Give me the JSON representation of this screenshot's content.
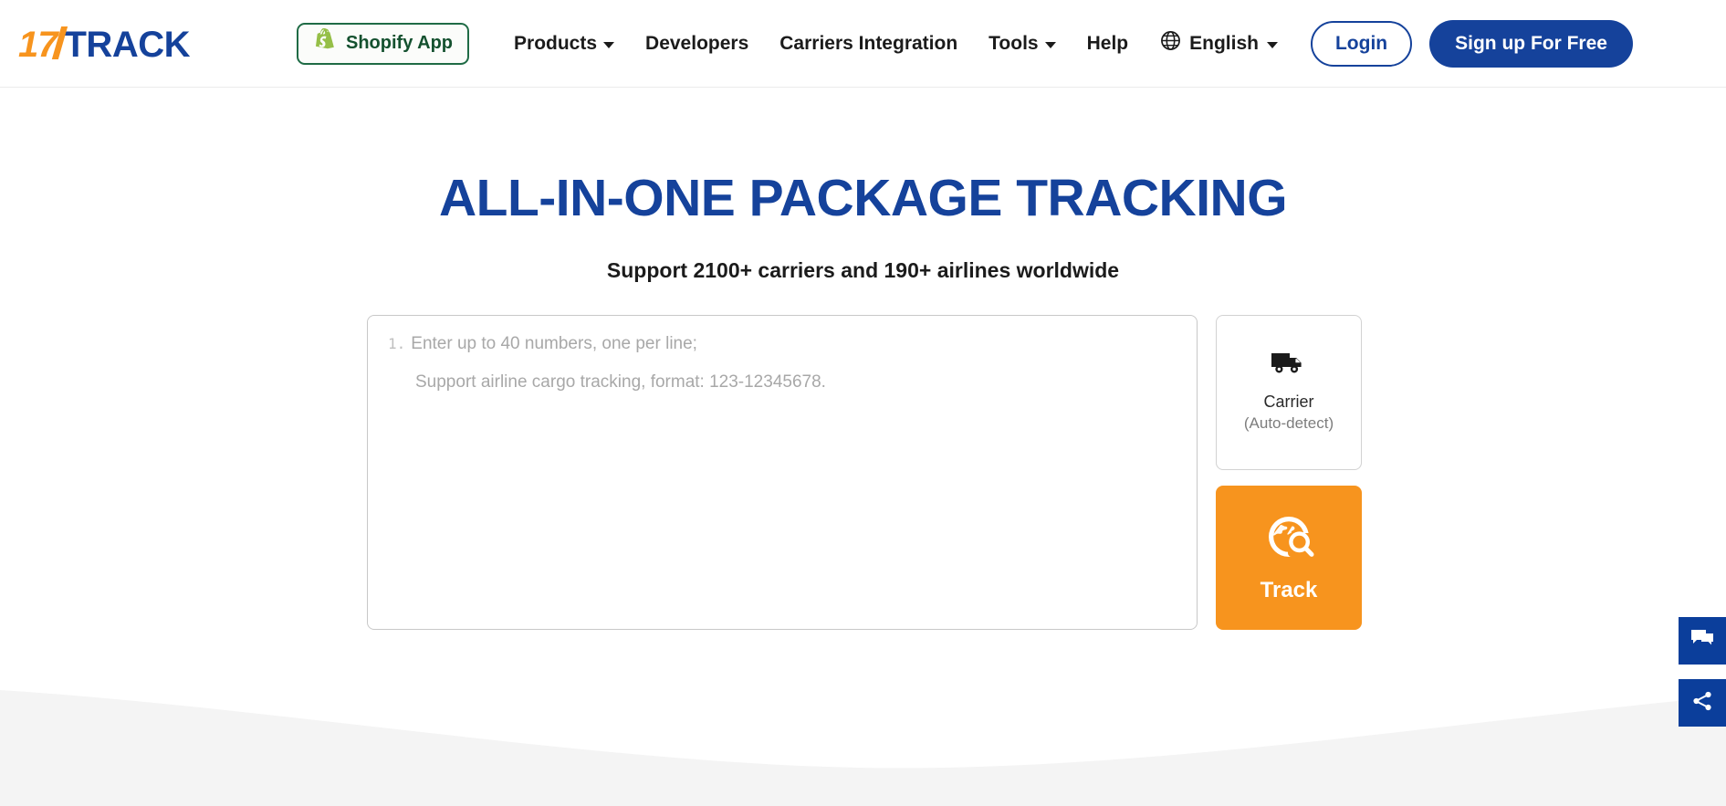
{
  "brand": {
    "logo_17": "17",
    "logo_track": "TRACK"
  },
  "header": {
    "shopify_button": {
      "label": "Shopify App",
      "icon": "shopify-bag-icon",
      "border_color": "#1f6b45",
      "text_color": "#14512f"
    },
    "nav": [
      {
        "label": "Products",
        "has_dropdown": true
      },
      {
        "label": "Developers",
        "has_dropdown": false
      },
      {
        "label": "Carriers Integration",
        "has_dropdown": false
      },
      {
        "label": "Tools",
        "has_dropdown": true
      },
      {
        "label": "Help",
        "has_dropdown": false
      }
    ],
    "language": {
      "label": "English",
      "icon": "globe-icon",
      "has_dropdown": true
    },
    "login_label": "Login",
    "signup_label": "Sign up For Free"
  },
  "hero": {
    "title": "ALL-IN-ONE PACKAGE TRACKING",
    "subtitle": "Support 2100+ carriers and 190+ airlines worldwide",
    "title_color": "#15429B"
  },
  "tracking": {
    "textarea": {
      "line_number": "1.",
      "placeholder_line1": "Enter up to 40 numbers, one per line;",
      "placeholder_line2": "Support airline cargo tracking, format: 123-12345678.",
      "value": ""
    },
    "carrier": {
      "icon": "truck-icon",
      "label": "Carrier",
      "sublabel": "(Auto-detect)"
    },
    "track_button": {
      "icon": "globe-search-icon",
      "label": "Track",
      "color": "#F7941E"
    }
  },
  "side_rail": {
    "buttons": [
      {
        "icon": "chat-feedback-icon",
        "name": "feedback"
      },
      {
        "icon": "share-icon",
        "name": "share"
      }
    ],
    "color": "#0B3E9B"
  },
  "colors": {
    "brand_blue": "#15429B",
    "brand_orange": "#F7941E",
    "page_background": "#ffffff",
    "wave_background": "#f4f4f4"
  }
}
